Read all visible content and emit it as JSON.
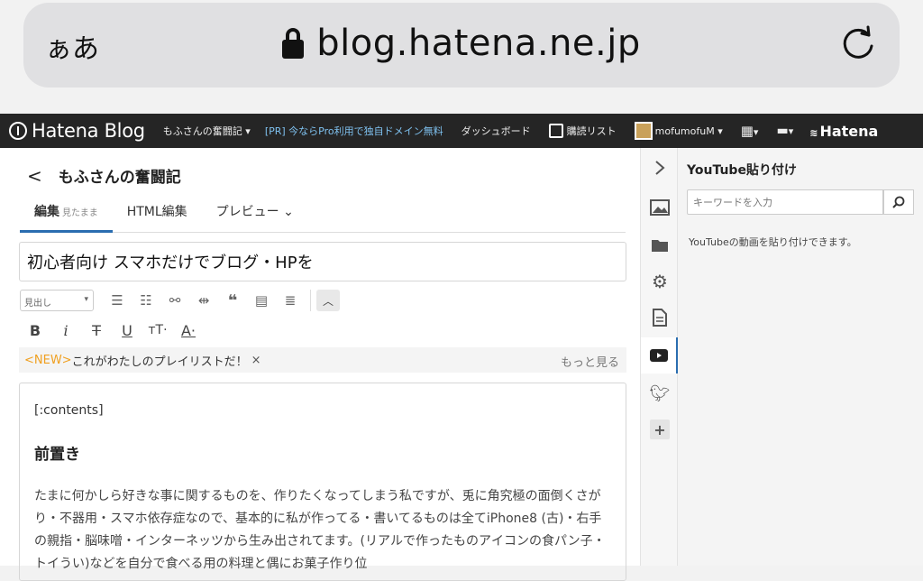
{
  "browser": {
    "text_size_label": "ぁあ",
    "url": "blog.hatena.ne.jp"
  },
  "navbar": {
    "logo": "Hatena Blog",
    "blog_menu": "もふさんの奮闘記 ▾",
    "promo": "[PR] 今ならPro利用で独自ドメイン無料",
    "dashboard": "ダッシュボード",
    "reading_list": "購読リスト",
    "user": "mofumofuM ▾",
    "apps": "▾",
    "notifications": "▾",
    "brand": "Hatena"
  },
  "editor": {
    "back_title": "もふさんの奮闘記",
    "tabs": {
      "edit": "編集",
      "edit_mode": "見たまま",
      "html": "HTML編集",
      "preview": "プレビュー ⌄"
    },
    "title_value": "初心者向け スマホだけでブログ・HPを",
    "style_select": "見出し",
    "news": {
      "tag": "<NEW>",
      "text": "これがわたしのプレイリストだ！",
      "close": "×",
      "more": "もっと見る"
    },
    "body": {
      "code": "[:contents]",
      "heading": "前置き",
      "paragraph": "たまに何かしら好きな事に関するものを、作りたくなってしまう私ですが、兎に角究極の面倒くさがり・不器用・スマホ依存症なので、基本的に私が作ってる・書いてるものは全てiPhone8 (古)・右手の親指・脳味噌・インターネッツから生み出されてます。(リアルで作ったものアイコンの食パン子・トイうい)などを自分で食べる用の料理と偶にお菓子作り位"
    }
  },
  "panel": {
    "title": "YouTube貼り付け",
    "search_placeholder": "キーワードを入力",
    "description": "YouTubeの動画を貼り付けできます。"
  },
  "colors": {
    "navbar_bg": "#252525",
    "accent": "#2a6db0",
    "new_tag": "#f0a020",
    "promo": "#7ec0ee"
  }
}
